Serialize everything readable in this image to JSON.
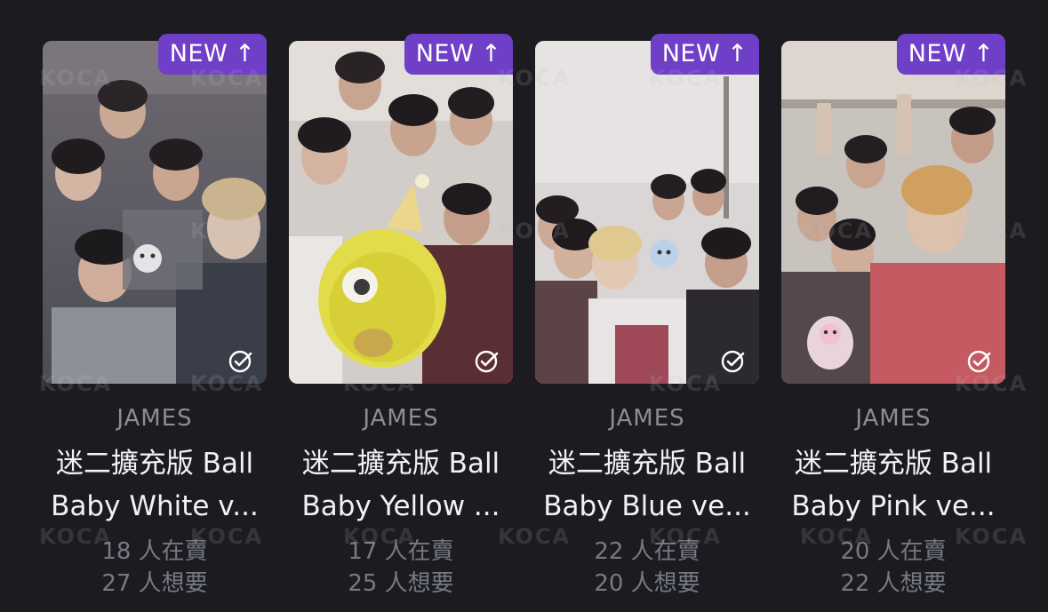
{
  "watermark": "KOCA",
  "cards": [
    {
      "badge": "NEW",
      "badge_arrow": "↑",
      "artist": "JAMES",
      "title_line1": "迷二擴充版 Ball",
      "title_line2": "Baby White v...",
      "sellers": "18 人在賣",
      "wanters": "27 人想要",
      "mascot": "white"
    },
    {
      "badge": "NEW",
      "badge_arrow": "↑",
      "artist": "JAMES",
      "title_line1": "迷二擴充版 Ball",
      "title_line2": "Baby Yellow ...",
      "sellers": "17 人在賣",
      "wanters": "25 人想要",
      "mascot": "yellow"
    },
    {
      "badge": "NEW",
      "badge_arrow": "↑",
      "artist": "JAMES",
      "title_line1": "迷二擴充版 Ball",
      "title_line2": "Baby Blue ve...",
      "sellers": "22 人在賣",
      "wanters": "20 人想要",
      "mascot": "blue"
    },
    {
      "badge": "NEW",
      "badge_arrow": "↑",
      "artist": "JAMES",
      "title_line1": "迷二擴充版 Ball",
      "title_line2": "Baby Pink ve...",
      "sellers": "20 人在賣",
      "wanters": "22 人想要",
      "mascot": "pink"
    }
  ],
  "colors": {
    "background": "#1c1b20",
    "badge": "#6f3fc8",
    "artist_text": "#8a8e98",
    "title_text": "#f2f2f4",
    "stat_text": "#767a84"
  }
}
